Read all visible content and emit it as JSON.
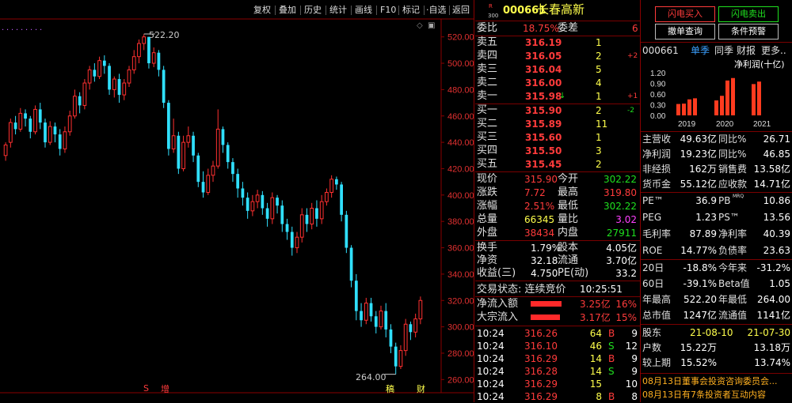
{
  "toolbar": {
    "items": [
      "复权",
      "叠加",
      "历史",
      "统计",
      "画线",
      "F10",
      "标记",
      "自选",
      "返回"
    ]
  },
  "chart_labels": {
    "high_label": "522.20",
    "low_label": "264.00",
    "markers": [
      "S",
      "增",
      "稿",
      "财"
    ]
  },
  "chart_data": {
    "type": "candlestick",
    "ylim": [
      250,
      530
    ],
    "yticks": [
      260,
      280,
      300,
      320,
      340,
      360,
      380,
      400,
      420,
      440,
      460,
      480,
      500,
      520
    ],
    "high_value": 522.2,
    "low_value": 264.0,
    "candles": [
      [
        430,
        438,
        426,
        440
      ],
      [
        440,
        455,
        436,
        458
      ],
      [
        455,
        450,
        446,
        460
      ],
      [
        450,
        462,
        448,
        466
      ],
      [
        462,
        458,
        452,
        465
      ],
      [
        458,
        448,
        443,
        460
      ],
      [
        448,
        465,
        446,
        468
      ],
      [
        465,
        455,
        450,
        470
      ],
      [
        455,
        440,
        436,
        458
      ],
      [
        440,
        452,
        438,
        456
      ],
      [
        452,
        446,
        440,
        455
      ],
      [
        446,
        435,
        430,
        450
      ],
      [
        435,
        448,
        432,
        452
      ],
      [
        448,
        460,
        445,
        464
      ],
      [
        460,
        475,
        458,
        480
      ],
      [
        475,
        468,
        462,
        478
      ],
      [
        468,
        485,
        465,
        488
      ],
      [
        485,
        495,
        480,
        498
      ],
      [
        495,
        490,
        486,
        500
      ],
      [
        490,
        502,
        488,
        505
      ],
      [
        502,
        498,
        492,
        506
      ],
      [
        498,
        480,
        476,
        500
      ],
      [
        480,
        488,
        474,
        490
      ],
      [
        488,
        476,
        470,
        492
      ],
      [
        476,
        485,
        472,
        488
      ],
      [
        485,
        495,
        482,
        498
      ],
      [
        495,
        505,
        492,
        510
      ],
      [
        505,
        515,
        500,
        518
      ],
      [
        515,
        520,
        510,
        522
      ],
      [
        520,
        500,
        496,
        520
      ],
      [
        500,
        508,
        497,
        512
      ],
      [
        508,
        495,
        490,
        510
      ],
      [
        495,
        470,
        466,
        498
      ],
      [
        470,
        435,
        430,
        472
      ],
      [
        435,
        445,
        432,
        458
      ],
      [
        445,
        420,
        416,
        448
      ],
      [
        420,
        440,
        418,
        445
      ],
      [
        440,
        445,
        436,
        452
      ],
      [
        445,
        430,
        425,
        448
      ],
      [
        430,
        410,
        406,
        432
      ],
      [
        410,
        402,
        398,
        418
      ],
      [
        402,
        415,
        400,
        420
      ],
      [
        415,
        422,
        410,
        426
      ],
      [
        422,
        450,
        420,
        465
      ],
      [
        450,
        438,
        432,
        452
      ],
      [
        438,
        425,
        420,
        440
      ],
      [
        425,
        416,
        410,
        428
      ],
      [
        416,
        405,
        398,
        420
      ],
      [
        405,
        398,
        392,
        410
      ],
      [
        398,
        388,
        382,
        402
      ],
      [
        388,
        395,
        384,
        400
      ],
      [
        395,
        400,
        390,
        404
      ],
      [
        400,
        390,
        385,
        403
      ],
      [
        390,
        382,
        376,
        394
      ],
      [
        382,
        398,
        378,
        402
      ],
      [
        398,
        392,
        386,
        400
      ],
      [
        392,
        378,
        372,
        396
      ],
      [
        378,
        372,
        366,
        382
      ],
      [
        372,
        360,
        354,
        376
      ],
      [
        360,
        368,
        356,
        372
      ],
      [
        368,
        385,
        364,
        390
      ],
      [
        385,
        378,
        372,
        390
      ],
      [
        378,
        390,
        374,
        394
      ],
      [
        390,
        382,
        376,
        396
      ],
      [
        382,
        395,
        378,
        400
      ],
      [
        395,
        402,
        392,
        405
      ],
      [
        402,
        412,
        398,
        415
      ],
      [
        412,
        408,
        404,
        414
      ],
      [
        408,
        385,
        380,
        410
      ],
      [
        385,
        360,
        356,
        388
      ],
      [
        360,
        335,
        330,
        362
      ],
      [
        335,
        312,
        305,
        340
      ],
      [
        312,
        305,
        300,
        318
      ],
      [
        305,
        318,
        302,
        322
      ],
      [
        318,
        308,
        304,
        322
      ],
      [
        308,
        300,
        295,
        312
      ],
      [
        300,
        312,
        298,
        316
      ],
      [
        312,
        298,
        292,
        318
      ],
      [
        298,
        285,
        280,
        302
      ],
      [
        285,
        270,
        264,
        288
      ],
      [
        270,
        282,
        268,
        286
      ],
      [
        282,
        302,
        278,
        306
      ],
      [
        302,
        296,
        290,
        304
      ],
      [
        296,
        306,
        292,
        310
      ],
      [
        306,
        320,
        302,
        323
      ]
    ]
  },
  "quote": {
    "code": "000661",
    "name": "长春高新",
    "r_tag": "R",
    "r_num": "300",
    "weibi_label": "委比",
    "weibi": "18.75%",
    "weicha_label": "委差",
    "weicha": "6",
    "asks": [
      {
        "label": "卖五",
        "price": "316.19",
        "vol": "1",
        "chg": ""
      },
      {
        "label": "卖四",
        "price": "316.05",
        "vol": "2",
        "chg": "+2"
      },
      {
        "label": "卖三",
        "price": "316.04",
        "vol": "5",
        "chg": ""
      },
      {
        "label": "卖二",
        "price": "316.00",
        "vol": "4",
        "chg": ""
      },
      {
        "label": "卖一",
        "price": "315.98",
        "vol": "1",
        "chg": "+1"
      }
    ],
    "bids": [
      {
        "label": "买一",
        "price": "315.90",
        "vol": "2",
        "chg": "-2"
      },
      {
        "label": "买二",
        "price": "315.89",
        "vol": "11",
        "chg": ""
      },
      {
        "label": "买三",
        "price": "315.60",
        "vol": "1",
        "chg": ""
      },
      {
        "label": "买四",
        "price": "315.50",
        "vol": "3",
        "chg": ""
      },
      {
        "label": "买五",
        "price": "315.45",
        "vol": "2",
        "chg": ""
      }
    ],
    "stats": [
      {
        "l1": "现价",
        "v1": "315.90",
        "c1": "red",
        "l2": "今开",
        "v2": "302.22",
        "c2": "green"
      },
      {
        "l1": "涨跌",
        "v1": "7.72",
        "c1": "red",
        "l2": "最高",
        "v2": "319.80",
        "c2": "red"
      },
      {
        "l1": "涨幅",
        "v1": "2.51%",
        "c1": "red",
        "l2": "最低",
        "v2": "302.22",
        "c2": "green"
      },
      {
        "l1": "总量",
        "v1": "66345",
        "c1": "yellow",
        "l2": "量比",
        "v2": "3.02",
        "c2": "magenta"
      },
      {
        "l1": "外盘",
        "v1": "38434",
        "c1": "red",
        "l2": "内盘",
        "v2": "27911",
        "c2": "green"
      }
    ],
    "stats2": [
      {
        "l1": "换手",
        "v1": "1.79%",
        "l2": "股本",
        "v2": "4.05亿"
      },
      {
        "l1": "净资",
        "v1": "32.18",
        "l2": "流通",
        "v2": "3.70亿"
      },
      {
        "l1": "收益(三)",
        "v1": "4.750",
        "l2": "PE(动)",
        "v2": "33.2"
      }
    ],
    "trade_status": "交易状态: 连续竞价",
    "trade_time": "10:25:51",
    "flows": [
      {
        "label": "净流入额",
        "value": "3.25亿",
        "pct": "16%",
        "bar": 0.65
      },
      {
        "label": "大宗流入",
        "value": "3.17亿",
        "pct": "15%",
        "bar": 0.62
      }
    ],
    "ticks": [
      {
        "time": "10:24",
        "price": "316.26",
        "vol": "64",
        "side": "B",
        "n": "9"
      },
      {
        "time": "10:24",
        "price": "316.10",
        "vol": "46",
        "side": "S",
        "n": "12"
      },
      {
        "time": "10:24",
        "price": "316.29",
        "vol": "14",
        "side": "B",
        "n": "9"
      },
      {
        "time": "10:24",
        "price": "316.28",
        "vol": "14",
        "side": "S",
        "n": "9"
      },
      {
        "time": "10:24",
        "price": "316.29",
        "vol": "15",
        "side": "",
        "n": "10"
      },
      {
        "time": "10:24",
        "price": "316.29",
        "vol": "8",
        "side": "B",
        "n": "8"
      }
    ]
  },
  "side": {
    "buttons": [
      "闪电买入",
      "闪电卖出",
      "撤单查询",
      "条件预警"
    ],
    "code": "000661",
    "tabs": [
      "单季",
      "同季",
      "财报",
      "更多.."
    ],
    "profit_title": "净利润(十亿)",
    "yaxis": [
      "1.20",
      "0.90",
      "0.60",
      "0.30",
      "0.00"
    ],
    "years": [
      "2019",
      "2020",
      "2021"
    ],
    "bars": [
      0.32,
      0.33,
      0.45,
      0.48,
      0.42,
      0.55,
      0.98,
      1.05,
      0.88,
      0.95
    ],
    "fin_rows": [
      {
        "l1": "主营收",
        "v1": "49.63亿",
        "l2": "同比%",
        "v2": "26.71"
      },
      {
        "l1": "净利润",
        "v1": "19.23亿",
        "l2": "同比%",
        "v2": "46.85"
      },
      {
        "l1": "非经损",
        "v1": "162万",
        "l2": "销售费",
        "v2": "13.58亿"
      },
      {
        "l1": "货币金",
        "v1": "55.12亿",
        "l2": "应收款",
        "v2": "14.71亿"
      }
    ],
    "val_rows": [
      {
        "l1": "PE™",
        "v1": "36.9",
        "l2": "PB",
        "sup": "MRQ",
        "v2": "10.86"
      },
      {
        "l1": "PEG",
        "v1": "1.23",
        "l2": "PS™",
        "sup": "",
        "v2": "13.56"
      },
      {
        "l1": "毛利率",
        "v1": "87.89",
        "l2": "净利率",
        "sup": "",
        "v2": "40.39"
      },
      {
        "l1": "ROE",
        "v1": "14.77%",
        "l2": "负债率",
        "sup": "",
        "v2": "23.63"
      }
    ],
    "perf_rows": [
      {
        "l1": "20日",
        "v1": "-18.8%",
        "l2": "今年来",
        "v2": "-31.2%"
      },
      {
        "l1": "60日",
        "v1": "-39.1%",
        "l2": "Beta值",
        "v2": "1.05"
      },
      {
        "l1": "年最高",
        "v1": "522.20",
        "l2": "年最低",
        "v2": "264.00"
      },
      {
        "l1": "总市值",
        "v1": "1247亿",
        "l2": "流通值",
        "v2": "1141亿"
      }
    ],
    "holder_header": {
      "label": "股东",
      "d1": "21-08-10",
      "d2": "21-07-30"
    },
    "holder_rows": [
      {
        "label": "户数",
        "v1": "15.22万",
        "v2": "13.18万"
      },
      {
        "label": "较上期",
        "v1": "15.52%",
        "v2": "13.74%"
      }
    ],
    "news": [
      "08月13日董事会投资咨询委员会...",
      "08月13日有7条投资者互动内容"
    ]
  }
}
